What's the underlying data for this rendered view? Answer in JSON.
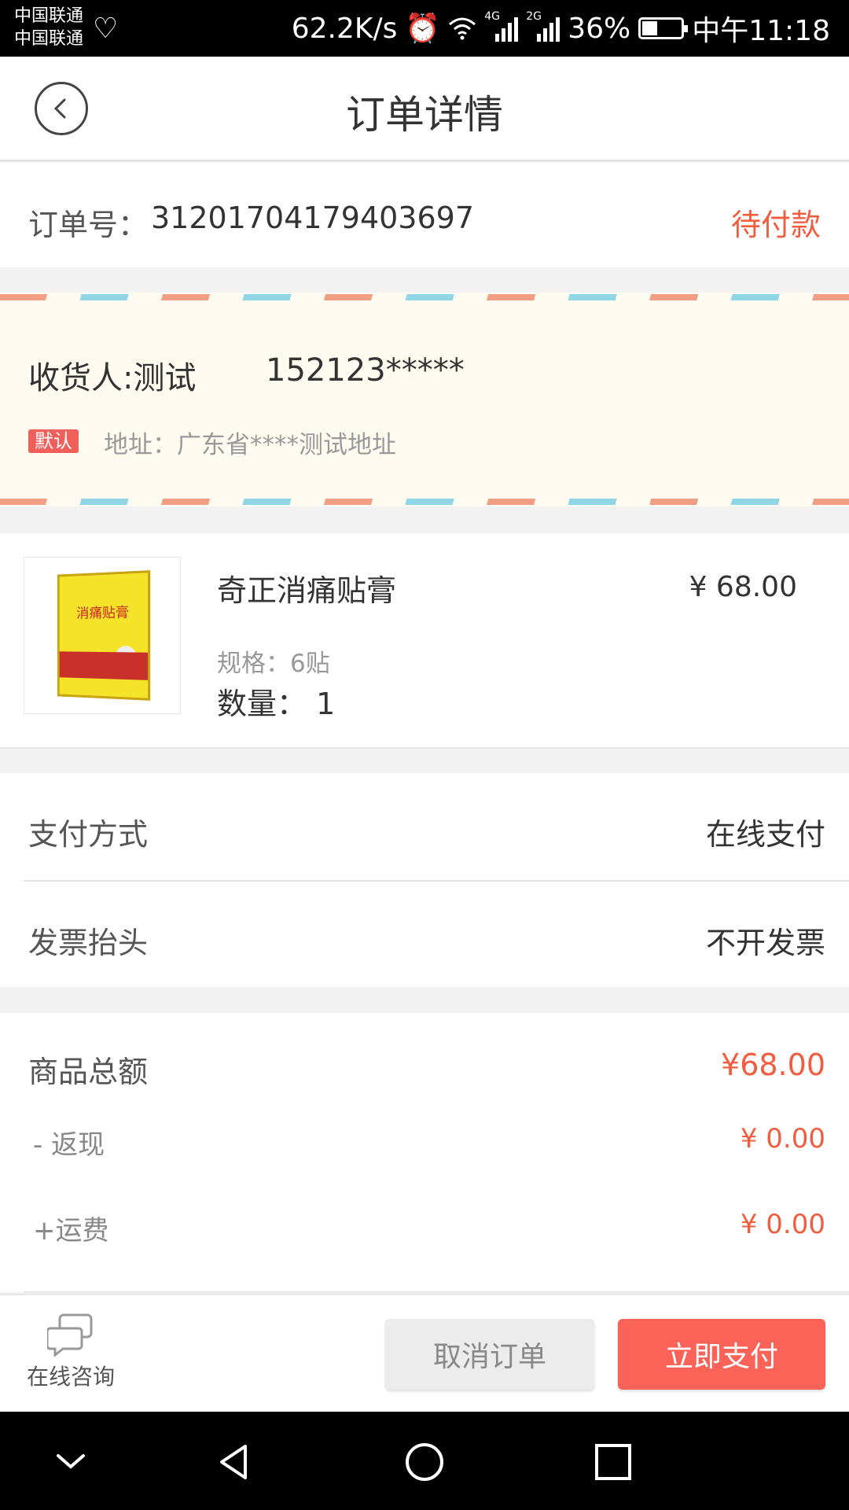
{
  "status_bar": {
    "carrier1": "中国联通",
    "carrier2": "中国联通",
    "speed": "62.2K/s",
    "net1": "4G",
    "net2": "2G",
    "battery": "36%",
    "time": "中午11:18"
  },
  "header": {
    "title": "订单详情"
  },
  "order": {
    "number_label": "订单号：",
    "number": "312017041794036‍97",
    "status": "待付款"
  },
  "address": {
    "receiver": "收货人:测试",
    "phone": "152123*****",
    "badge": "默认",
    "text": "地址：广东省****测试地址"
  },
  "product": {
    "box_text": "消痛贴膏",
    "name": "奇正消痛贴膏",
    "price": "¥ 68.00",
    "spec": "规格：6贴",
    "qty": "数量：  1"
  },
  "payment": [
    {
      "key": "支付方式",
      "value": "在线支付"
    },
    {
      "key": "发票抬头",
      "value": "不开发票"
    }
  ],
  "summary": {
    "total_label": "商品总额",
    "total_value": "¥68.00",
    "cashback_label": "- 返现",
    "cashback_value": "¥ 0.00",
    "shipping_label": "+运费",
    "shipping_value": "¥ 0.00"
  },
  "actions": {
    "consult": "在线咨询",
    "cancel": "取消订单",
    "pay": "立即支付"
  },
  "colors": {
    "accent": "#f25c3f",
    "pay_button": "#fb6358",
    "envelope_bg": "#fffbf0"
  }
}
